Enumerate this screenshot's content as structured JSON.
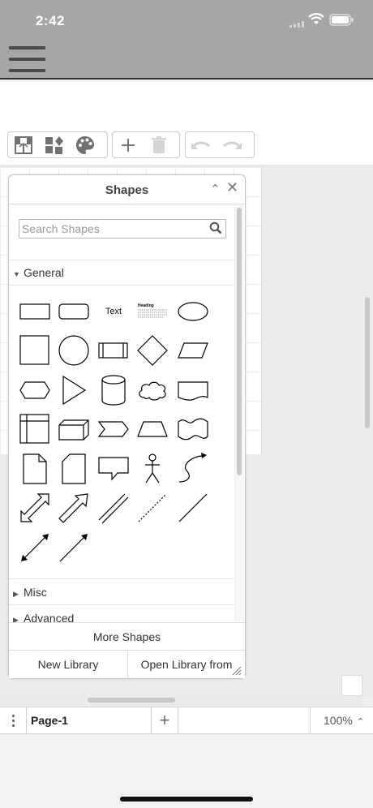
{
  "status": {
    "time": "2:42"
  },
  "toolbar": {
    "icons": [
      "format-icon",
      "shapes-icon",
      "palette-icon",
      "plus-icon",
      "trash-icon",
      "undo-icon",
      "redo-icon"
    ]
  },
  "shapes_panel": {
    "title": "Shapes",
    "search_placeholder": "Search Shapes",
    "sections": {
      "general": "General",
      "misc": "Misc",
      "advanced": "Advanced"
    },
    "text_shape_label": "Text",
    "heading_shape_label": "Heading",
    "more_shapes": "More Shapes",
    "new_library": "New Library",
    "open_library": "Open Library from"
  },
  "bottom_bar": {
    "page_name": "Page-1",
    "add_page": "+",
    "zoom": "100%"
  },
  "colors": {
    "status_bg": "#a6a6a6",
    "canvas_bg": "#ececec",
    "panel_border": "#c3c3c3"
  }
}
